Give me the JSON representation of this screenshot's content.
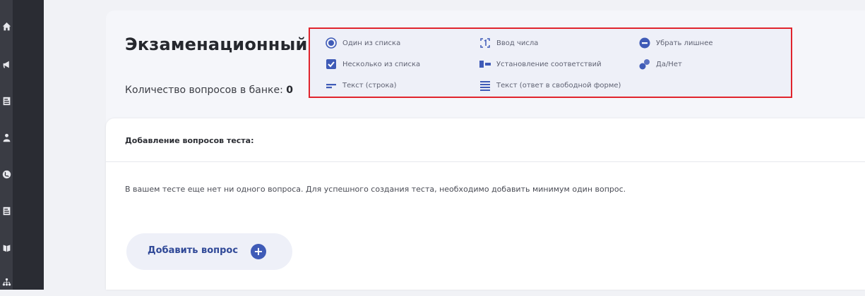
{
  "header": {
    "title": "Экзаменационный",
    "bank_count_label": "Количество вопросов в банке:",
    "bank_count_value": "0"
  },
  "question_types": [
    {
      "label": "Один из списка",
      "icon": "radio-icon"
    },
    {
      "label": "Несколько из списка",
      "icon": "checkbox-icon"
    },
    {
      "label": "Текст (строка)",
      "icon": "text-line-icon"
    },
    {
      "label": "Ввод числа",
      "icon": "number-input-icon"
    },
    {
      "label": "Установление соответствий",
      "icon": "matching-icon"
    },
    {
      "label": "Текст (ответ в свободной форме)",
      "icon": "text-block-icon"
    },
    {
      "label": "Убрать лишнее",
      "icon": "remove-extra-icon"
    },
    {
      "label": "Да/Нет",
      "icon": "yes-no-icon"
    }
  ],
  "main": {
    "section_title": "Добавление вопросов теста:",
    "empty_message": "В вашем тесте еще нет ни одного вопроса. Для успешного создания теста, необходимо добавить минимум один вопрос.",
    "add_button_label": "Добавить вопрос",
    "add_button_icon": "plus-icon"
  },
  "sidebar": {
    "items": [
      "home-icon",
      "megaphone-icon",
      "document-icon",
      "users-icon",
      "globe-icon",
      "document-icon",
      "book-icon",
      "org-icon"
    ]
  },
  "colors": {
    "accent": "#3f5bb7",
    "highlight_border": "#e0242d",
    "sidebar": "#2a2c33"
  }
}
